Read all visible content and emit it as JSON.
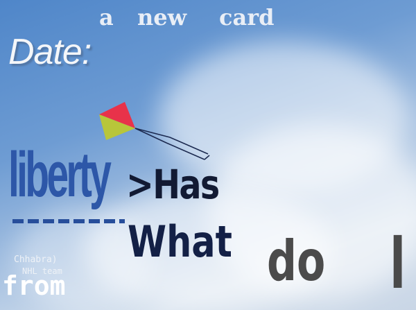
{
  "title": {
    "a": "a",
    "new": "new",
    "card": "card"
  },
  "date_label": "Date:",
  "words": {
    "liberty": "liberty",
    "has": ">Has",
    "what": "What",
    "do": "do",
    "i": "I"
  },
  "footer": {
    "chhabra": "Chhabra)",
    "nhl": "NHL team",
    "from": "from"
  },
  "colors": {
    "sky": "#5b8fcf",
    "kite_top": "#e8324a",
    "kite_bottom": "#b8c63a",
    "liberty": "#2d57a8"
  }
}
